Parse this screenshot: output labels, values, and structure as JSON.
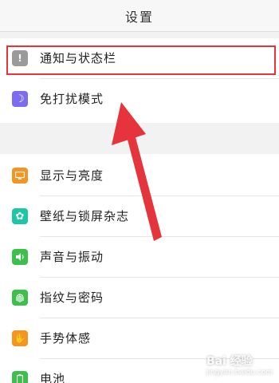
{
  "header": {
    "title": "设置"
  },
  "groups": [
    {
      "items": [
        {
          "label": "通知与状态栏",
          "icon": "exclamation-icon",
          "icon_color": "#9a9a9a",
          "glyph": "!"
        },
        {
          "label": "免打扰模式",
          "icon": "moon-icon",
          "icon_color": "#7b6cf0",
          "glyph": "☽"
        }
      ]
    },
    {
      "items": [
        {
          "label": "显示与亮度",
          "icon": "display-icon",
          "icon_color": "#f59420",
          "glyph": "▭"
        },
        {
          "label": "壁纸与锁屏杂志",
          "icon": "flower-icon",
          "icon_color": "#1dc7a5",
          "glyph": "✿"
        },
        {
          "label": "声音与振动",
          "icon": "speaker-icon",
          "icon_color": "#3dbf4b",
          "glyph": "◀"
        },
        {
          "label": "指纹与密码",
          "icon": "fingerprint-icon",
          "icon_color": "#3dbf4b",
          "glyph": "◎"
        },
        {
          "label": "手势体感",
          "icon": "hand-icon",
          "icon_color": "#f59420",
          "glyph": "✋"
        },
        {
          "label": "电池",
          "icon": "battery-icon",
          "icon_color": "#3dbf4b",
          "glyph": "▮"
        }
      ]
    }
  ],
  "colors": {
    "highlight": "#e5343b",
    "arrow": "#e5343b"
  },
  "watermark": {
    "text": "Bai 经验",
    "sub": "jingyan.baidu.com"
  }
}
